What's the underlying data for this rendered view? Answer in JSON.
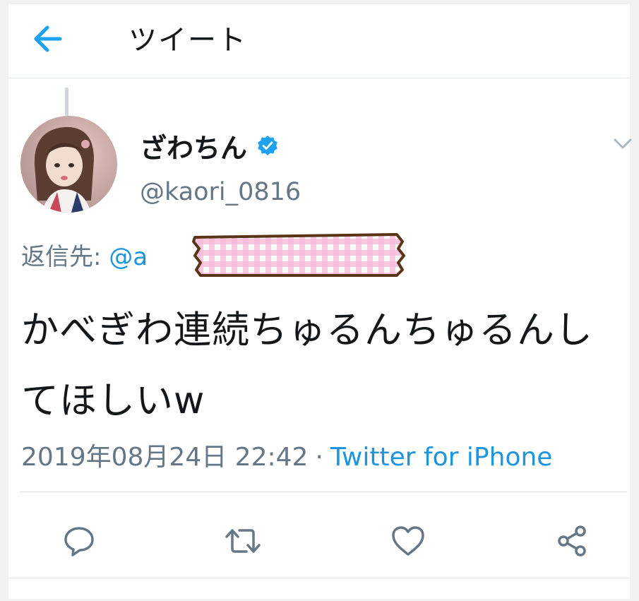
{
  "header": {
    "title": "ツイート",
    "back_icon": "arrow-left-icon"
  },
  "tweet": {
    "author_name": "ざわちん",
    "verified": true,
    "handle": "@kaori_0816",
    "reply_label": "返信先: ",
    "reply_mention": "@a",
    "text": "かべぎわ連続ちゅるんちゅるんしてほしいw",
    "timestamp": "2019年08月24日 22:42",
    "separator": "·",
    "source": "Twitter for iPhone"
  },
  "actions": [
    {
      "name": "reply",
      "icon": "reply-icon"
    },
    {
      "name": "retweet",
      "icon": "retweet-icon"
    },
    {
      "name": "like",
      "icon": "heart-icon"
    },
    {
      "name": "share",
      "icon": "share-icon"
    }
  ],
  "colors": {
    "accent": "#1b95e0",
    "text": "#14171a",
    "muted": "#657786",
    "redaction_pink": "#f7b6d8",
    "redaction_outline": "#5a3417"
  }
}
